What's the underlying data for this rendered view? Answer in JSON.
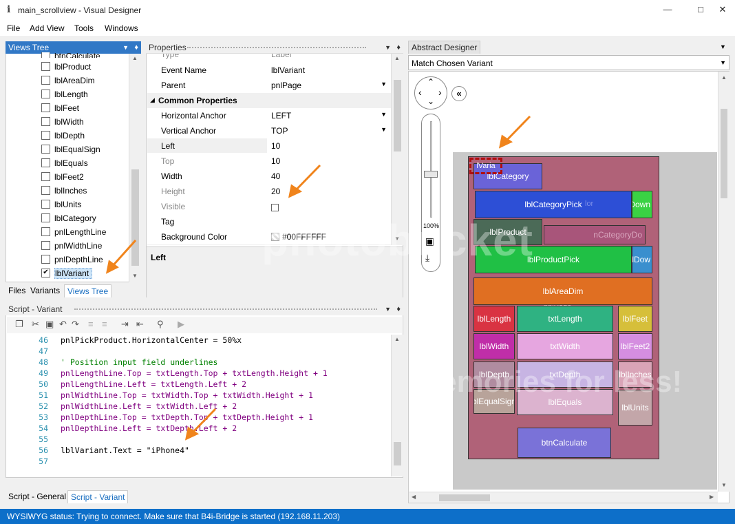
{
  "window": {
    "title": "main_scrollview - Visual Designer",
    "icon_glyph": "i"
  },
  "menu": [
    "File",
    "Add View",
    "Tools",
    "Windows"
  ],
  "views_tree": {
    "title": "Views Tree",
    "partial_top": "btnCalculate",
    "items": [
      "lblProduct",
      "lblAreaDim",
      "lblLength",
      "lblFeet",
      "lblWidth",
      "lblDepth",
      "lblEqualSign",
      "lblEquals",
      "lblFeet2",
      "lblInches",
      "lblUnits",
      "lblCategory",
      "pnlLengthLine",
      "pnlWidthLine",
      "pnlDepthLine",
      "lblVariant"
    ],
    "checked_item": "lblVariant",
    "bottom_tabs": [
      "Files",
      "Variants",
      "Views Tree"
    ]
  },
  "properties": {
    "title": "Properties",
    "rows": [
      {
        "name": "Type",
        "value": "Label",
        "kind": "partial"
      },
      {
        "name": "Event Name",
        "value": "lblVariant",
        "kind": "value"
      },
      {
        "name": "Parent",
        "value": "pnlPage",
        "kind": "dropdown"
      },
      {
        "name": "Common Properties",
        "value": "",
        "kind": "category"
      },
      {
        "name": "Horizontal Anchor",
        "value": "LEFT",
        "kind": "dropdown"
      },
      {
        "name": "Vertical Anchor",
        "value": "TOP",
        "kind": "dropdown"
      },
      {
        "name": "Left",
        "value": "10",
        "kind": "value"
      },
      {
        "name": "Top",
        "value": "10",
        "kind": "value"
      },
      {
        "name": "Width",
        "value": "40",
        "kind": "value"
      },
      {
        "name": "Height",
        "value": "20",
        "kind": "value"
      },
      {
        "name": "Visible",
        "value": "",
        "kind": "checkbox"
      },
      {
        "name": "Tag",
        "value": "",
        "kind": "value"
      },
      {
        "name": "Background Color",
        "value": "#00FFFFFF",
        "kind": "color"
      }
    ],
    "description": "Left"
  },
  "script": {
    "title": "Script - Variant",
    "lines": [
      {
        "n": "46",
        "text": "pnlPickProduct.HorizontalCenter = 50%x",
        "type": "txt"
      },
      {
        "n": "47",
        "text": "",
        "type": "txt"
      },
      {
        "n": "48",
        "text": "' Position input field underlines",
        "type": "cm"
      },
      {
        "n": "49",
        "text": "pnlLengthLine.Top = txtLength.Top + txtLength.Height + 1",
        "type": "kw"
      },
      {
        "n": "50",
        "text": "pnlLengthLine.Left = txtLength.Left + 2",
        "type": "kw"
      },
      {
        "n": "51",
        "text": "pnlWidthLine.Top = txtWidth.Top + txtWidth.Height + 1",
        "type": "kw"
      },
      {
        "n": "52",
        "text": "pnlWidthLine.Left = txtWidth.Left + 2",
        "type": "kw"
      },
      {
        "n": "53",
        "text": "pnlDepthLine.Top = txtDepth.Top + txtDepth.Height + 1",
        "type": "kw"
      },
      {
        "n": "54",
        "text": "pnlDepthLine.Left = txtDepth.Left + 2",
        "type": "kw"
      },
      {
        "n": "55",
        "text": "",
        "type": "txt"
      },
      {
        "n": "56",
        "text": "lblVariant.Text = \"iPhone4\"",
        "type": "txt"
      },
      {
        "n": "57",
        "text": "",
        "type": "txt"
      }
    ],
    "bottom_tabs": [
      "Script - General",
      "Script - Variant"
    ]
  },
  "designer": {
    "title": "Abstract Designer",
    "variant_select": "Match Chosen Variant",
    "zoom": "100%",
    "zoom_fraction": 0.55,
    "views": {
      "lblVariant": "lVaria",
      "lblCategory": "lblCategory",
      "lblCategoryPick": "lblCategoryPick",
      "catDown": "tDown",
      "lblProduct": "lblProduct",
      "catDrop": "nCategoryDo",
      "lblProductPick": "lblProductPick",
      "prodDown": "dDow",
      "lblAreaDim": "lblAreaDim",
      "pnlPage": "pnlPage",
      "lblLength": "lblLength",
      "txtLength": "txtLength",
      "lblFeet": "lblFeet",
      "lblWidth": "lblWidth",
      "txtWidth": "txtWidth",
      "lblFeet2": "lblFeet2",
      "lblDepth": "lblDepth",
      "txtDepth": "txtDepth",
      "lblInches": "lblInches",
      "lblEqualSign": "blEqualSign",
      "lblEquals": "lblEquals",
      "lblUnits": "lblUnits",
      "btnCalculate": "btnCalculate",
      "ghostLabel": "lor"
    }
  },
  "status": "WYSIWYG status: Trying to connect. Make sure that B4i-Bridge is started (192.168.11.203)",
  "watermark": {
    "logo": "photobucket",
    "tagline": "memories for less!"
  },
  "colors": {
    "accent": "#3178c6",
    "status_bar": "#0d6fc9",
    "arrow": "#f0841c"
  }
}
